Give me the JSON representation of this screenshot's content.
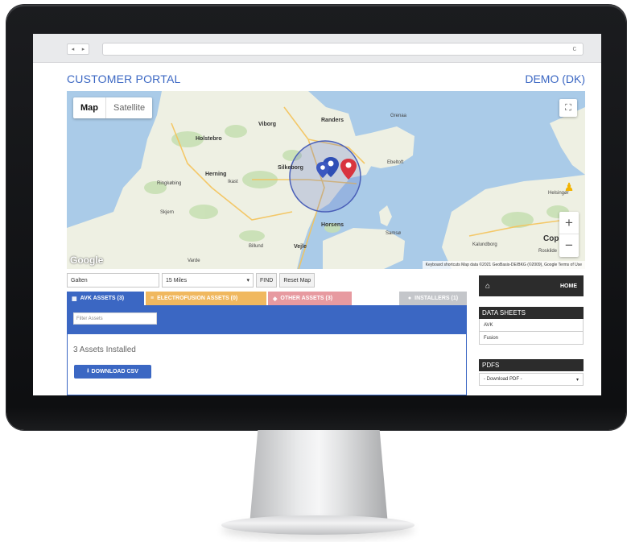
{
  "browser": {
    "nav_back": "◂",
    "nav_forward": "▸",
    "reload_icon": "c"
  },
  "header": {
    "title": "CUSTOMER PORTAL",
    "account": "DEMO (DK)"
  },
  "map": {
    "type_map": "Map",
    "type_satellite": "Satellite",
    "google": "Google",
    "attribution": "Keyboard shortcuts   Map data ©2021 GeoBasis-DE/BKG (©2009), Google   Terms of Use",
    "cities": {
      "viborg": "Viborg",
      "randers": "Randers",
      "holstebro": "Holstebro",
      "herning": "Herning",
      "silkeborg": "Silkeborg",
      "horsens": "Horsens",
      "vejle": "Vejle",
      "grenaa": "Grenaa",
      "ebeltoft": "Ebeltoft",
      "ikast": "Ikast",
      "ringkobing": "Ringkøbing",
      "billund": "Billund",
      "skjern": "Skjern",
      "kalundborg": "Kalundborg",
      "roskilde": "Roskilde",
      "helsingor": "Helsingør",
      "varde": "Varde",
      "samso": "Samsø",
      "copenhagen": "Cop"
    },
    "colors": {
      "water": "#aacbe8",
      "land": "#f1efe7",
      "radius": "#4a5fb8"
    }
  },
  "search": {
    "location_value": "Galten",
    "radius_value": "15 Miles",
    "find_label": "FIND",
    "reset_label": "Reset Map"
  },
  "tabs": {
    "avk": "AVK ASSETS (3)",
    "electrofusion": "ELECTROFUSION ASSETS (0)",
    "other": "OTHER ASSETS (3)",
    "install": "INSTALLERS (1)"
  },
  "assets": {
    "filter_placeholder": "Filter Assets",
    "count_text": "3 Assets Installed",
    "download_label": "DOWNLOAD CSV"
  },
  "sidebar": {
    "home_label": "HOME",
    "datasheets_title": "DATA SHEETS",
    "datasheets": [
      "AVK",
      "Fusion"
    ],
    "pdfs_title": "PDFS",
    "pdf_select_value": "- Download PDF -"
  },
  "colors": {
    "brand_blue": "#3b67c3",
    "electro_orange": "#f0b85f",
    "other_pink": "#e79aa0",
    "sidebar_dark": "#2c2c2c"
  }
}
